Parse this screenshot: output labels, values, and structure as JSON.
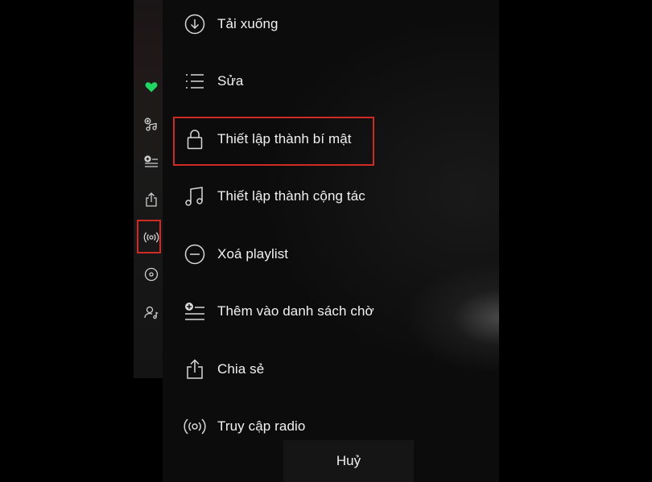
{
  "menu": {
    "items": [
      {
        "label": "Tải xuống",
        "icon": "download-circle-icon"
      },
      {
        "label": "Sửa",
        "icon": "edit-list-icon"
      },
      {
        "label": "Thiết lập thành bí mật",
        "icon": "lock-icon"
      },
      {
        "label": "Thiết lập thành cộng tác",
        "icon": "music-notes-icon"
      },
      {
        "label": "Xoá playlist",
        "icon": "minus-circle-icon"
      },
      {
        "label": "Thêm vào danh sách chờ",
        "icon": "add-to-queue-icon"
      },
      {
        "label": "Chia sẻ",
        "icon": "share-icon"
      },
      {
        "label": "Truy cập radio",
        "icon": "radio-icon"
      }
    ],
    "cancel_label": "Huỷ"
  },
  "side_strip": {
    "icons": [
      "heart-icon",
      "add-music-icon",
      "add-to-queue-icon",
      "share-icon",
      "radio-icon",
      "album-disc-icon",
      "artist-icon"
    ]
  },
  "colors": {
    "accent_green": "#1ed760",
    "highlight_red": "#d02a22",
    "text": "#f2f2f2",
    "icon": "#d8d8d8"
  }
}
